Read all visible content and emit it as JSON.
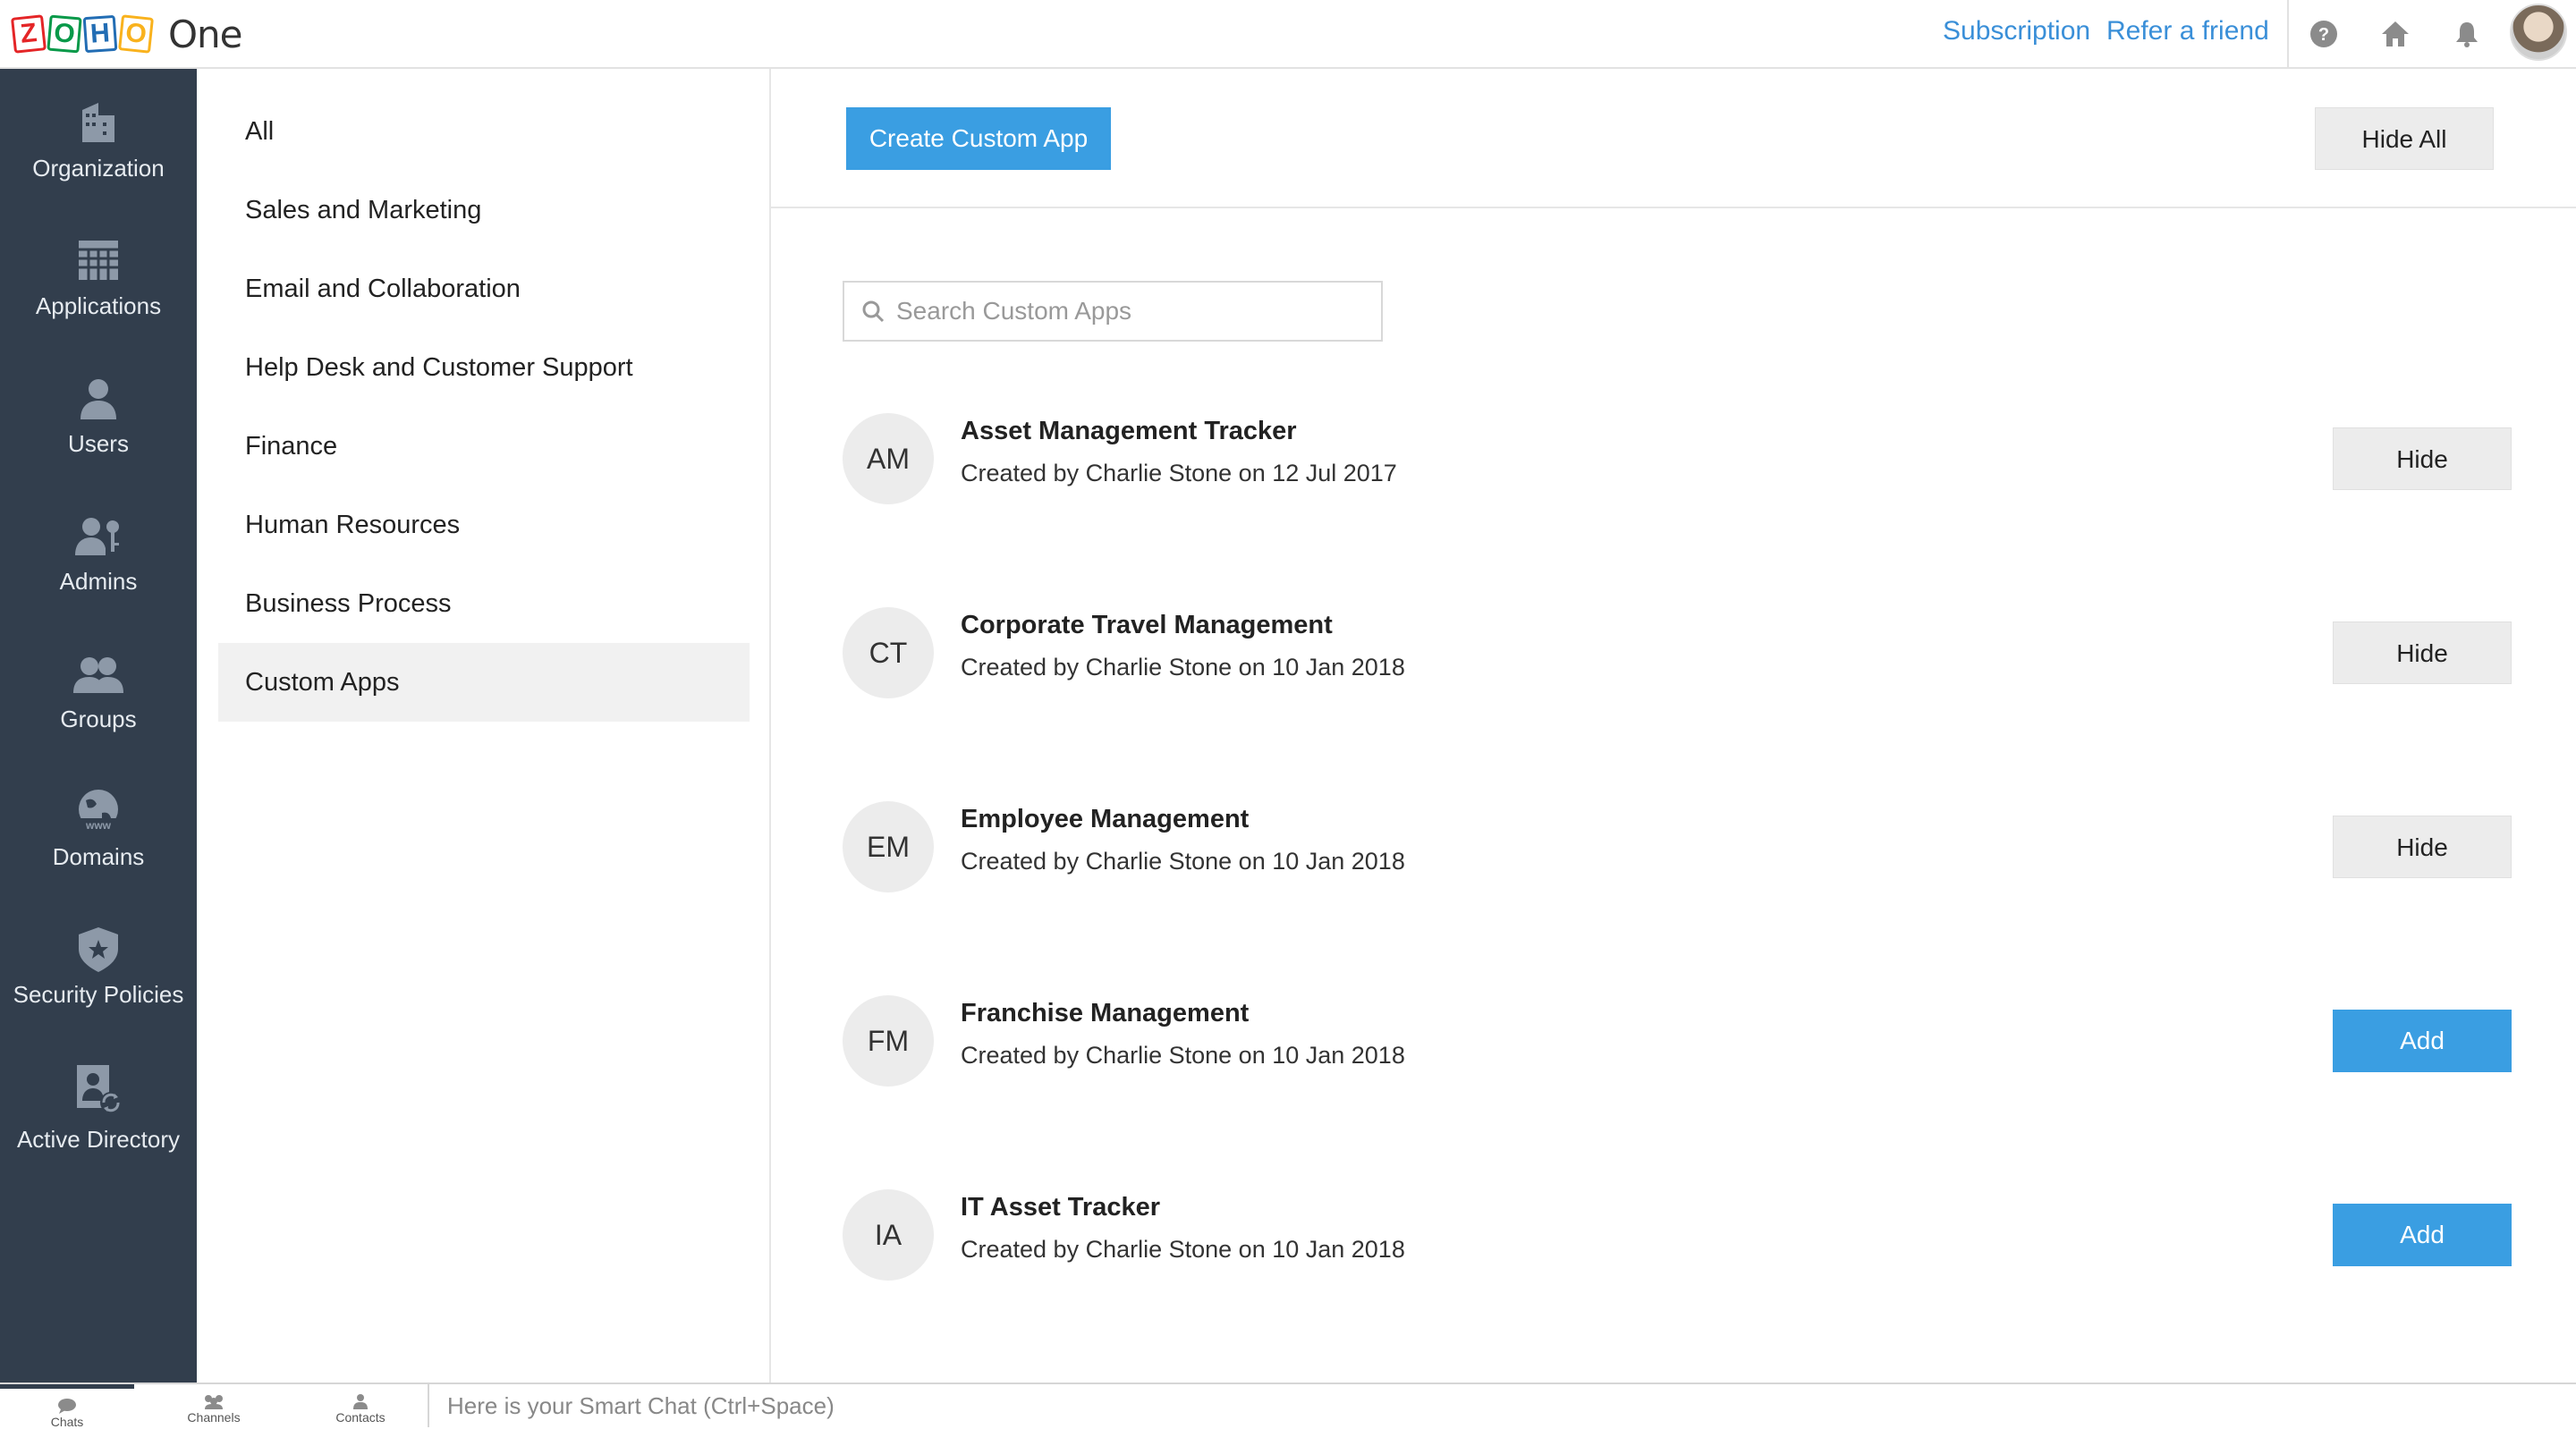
{
  "app": {
    "logo_letters": [
      "Z",
      "O",
      "H",
      "O"
    ],
    "logo_colors": [
      "#e42527",
      "#089949",
      "#226db4",
      "#f9b21d"
    ],
    "product": "One"
  },
  "topbar": {
    "subscription": "Subscription",
    "refer": "Refer a friend",
    "icons": [
      "help-icon",
      "home-icon",
      "bell-icon"
    ]
  },
  "sidebar": {
    "items": [
      {
        "label": "Organization",
        "icon": "building-icon"
      },
      {
        "label": "Applications",
        "icon": "grid-icon"
      },
      {
        "label": "Users",
        "icon": "user-icon"
      },
      {
        "label": "Admins",
        "icon": "admin-key-icon"
      },
      {
        "label": "Groups",
        "icon": "group-icon"
      },
      {
        "label": "Domains",
        "icon": "globe-www-icon"
      },
      {
        "label": "Security Policies",
        "icon": "shield-star-icon"
      },
      {
        "label": "Active Directory",
        "icon": "directory-sync-icon"
      }
    ],
    "colors": {
      "bg": "#323e4d",
      "text": "#e6ebf0",
      "icon": "#8d99a8"
    }
  },
  "categories": {
    "items": [
      "All",
      "Sales and Marketing",
      "Email and Collaboration",
      "Help Desk and Customer Support",
      "Finance",
      "Human Resources",
      "Business Process",
      "Custom Apps"
    ],
    "selected": "Custom Apps"
  },
  "main": {
    "create_button": "Create Custom App",
    "hide_all_button": "Hide All",
    "search_placeholder": "Search Custom Apps",
    "apps": [
      {
        "initials": "AM",
        "name": "Asset Management Tracker",
        "meta": "Created by Charlie Stone on 12 Jul 2017",
        "action": "Hide"
      },
      {
        "initials": "CT",
        "name": "Corporate Travel Management",
        "meta": "Created by Charlie Stone on 10 Jan 2018",
        "action": "Hide"
      },
      {
        "initials": "EM",
        "name": "Employee Management",
        "meta": "Created by Charlie Stone on 10 Jan 2018",
        "action": "Hide"
      },
      {
        "initials": "FM",
        "name": "Franchise Management",
        "meta": "Created by Charlie Stone on 10 Jan 2018",
        "action": "Add"
      },
      {
        "initials": "IA",
        "name": "IT Asset Tracker",
        "meta": "Created by Charlie Stone on 10 Jan 2018",
        "action": "Add"
      }
    ],
    "colors": {
      "accent": "#3a9ee2",
      "link": "#3a8fd8"
    }
  },
  "bottombar": {
    "tabs": [
      {
        "label": "Chats",
        "icon": "chat-icon"
      },
      {
        "label": "Channels",
        "icon": "channels-icon"
      },
      {
        "label": "Contacts",
        "icon": "contacts-icon"
      }
    ],
    "smartchat_placeholder": "Here is your Smart Chat (Ctrl+Space)"
  }
}
